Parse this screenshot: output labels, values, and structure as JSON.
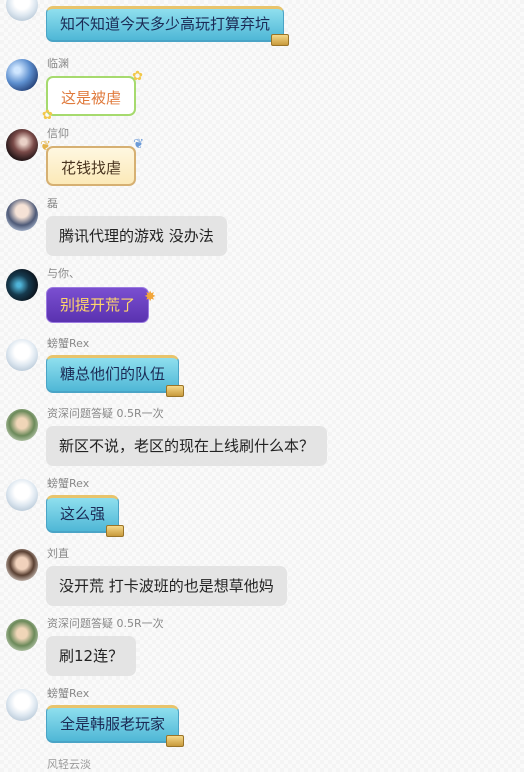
{
  "messages": [
    {
      "sender": "",
      "text": "知不知道今天多少高玩打算弃坑",
      "style": "blue",
      "avatar": "anime-girl-avatar"
    },
    {
      "sender": "临渊",
      "text": "这是被虐",
      "style": "green",
      "avatar": "planet-avatar"
    },
    {
      "sender": "信仰",
      "text": "花钱找虐",
      "style": "cream",
      "avatar": "dark-portrait-avatar"
    },
    {
      "sender": "磊",
      "text": "腾讯代理的游戏 没办法",
      "style": "plain",
      "avatar": "anime-boy-avatar"
    },
    {
      "sender": "与你、",
      "text": "别提开荒了",
      "style": "purple",
      "avatar": "night-scene-avatar"
    },
    {
      "sender": "螃蟹Rex",
      "text": "糖总他们的队伍",
      "style": "blue",
      "avatar": "anime-girl-avatar"
    },
    {
      "sender": "资深问题答疑 0.5R一次",
      "text": "新区不说，老区的现在上线刷什么本？",
      "style": "plain",
      "avatar": "game-character-avatar"
    },
    {
      "sender": "螃蟹Rex",
      "text": "这么强",
      "style": "blue",
      "avatar": "anime-girl-avatar"
    },
    {
      "sender": "刘直",
      "text": "没开荒 打卡波班的也是想草他妈",
      "style": "plain",
      "avatar": "face-avatar"
    },
    {
      "sender": "资深问题答疑 0.5R一次",
      "text": "刷12连？",
      "style": "plain",
      "avatar": "game-character-avatar"
    },
    {
      "sender": "螃蟹Rex",
      "text": "全是韩服老玩家",
      "style": "blue",
      "avatar": "anime-girl-avatar"
    }
  ],
  "next_sender": "风轻云淡",
  "colors": {
    "background": "#f4f4f4",
    "bubble_plain": "#e4e4e4",
    "bubble_blue": "#4fb7d6",
    "bubble_purple": "#5a32b0",
    "bubble_green_border": "#a6da6e",
    "bubble_cream_border": "#d6b072"
  }
}
